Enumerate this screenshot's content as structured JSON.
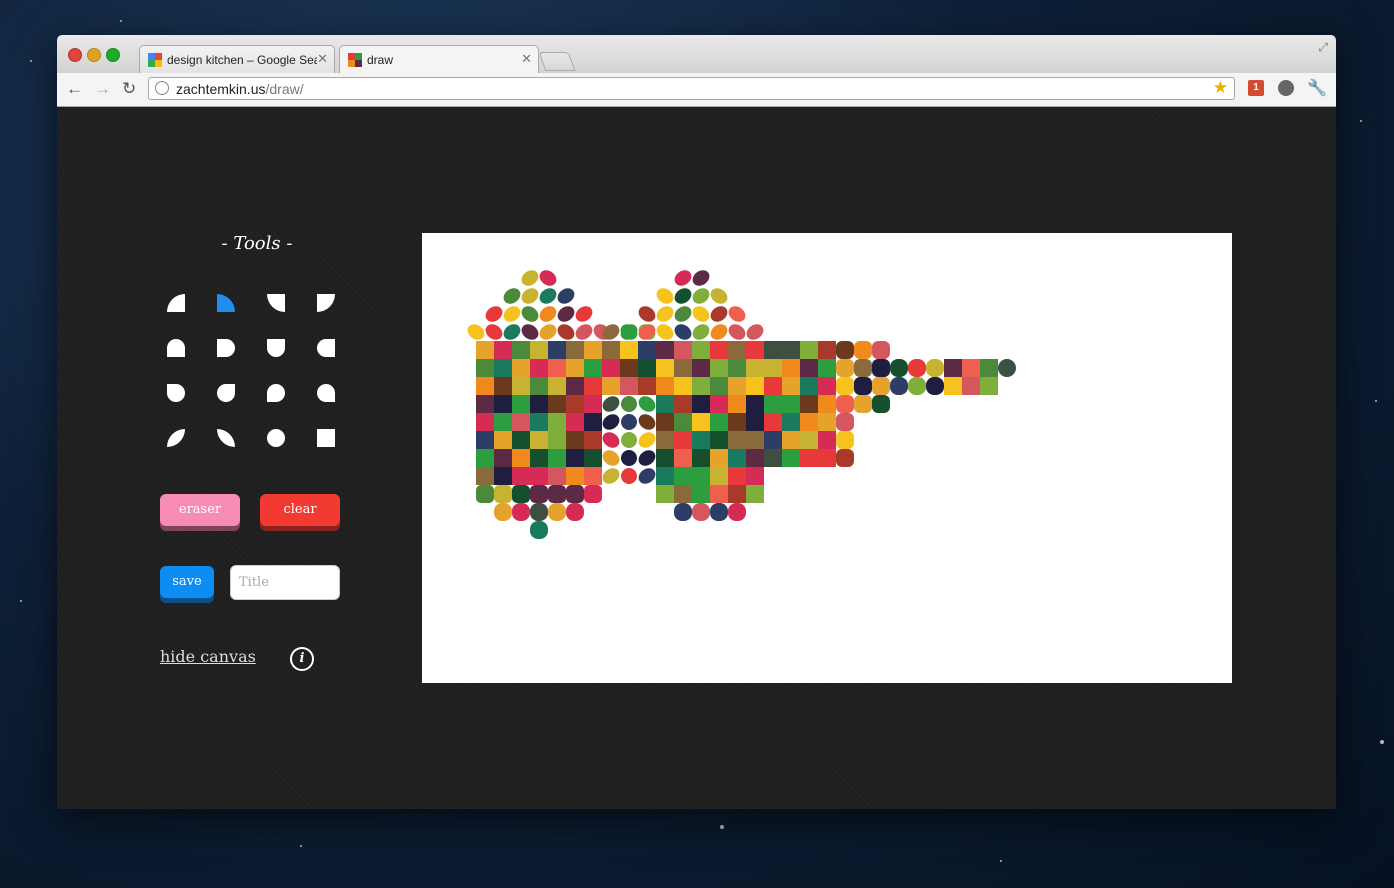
{
  "browser": {
    "tabs": [
      {
        "label": "design kitchen – Google Search",
        "active": false
      },
      {
        "label": "draw",
        "active": true
      }
    ],
    "url_host": "zachtemkin.us",
    "url_path": "/draw/",
    "extension_badge": "1"
  },
  "tools_panel": {
    "title": "- Tools -",
    "tools": [
      {
        "name": "quarter-top-left",
        "selected": false
      },
      {
        "name": "quarter-top-right",
        "selected": true
      },
      {
        "name": "quarter-bottom-left",
        "selected": false
      },
      {
        "name": "quarter-bottom-right",
        "selected": false
      },
      {
        "name": "half-round-top",
        "selected": false
      },
      {
        "name": "half-round-right",
        "selected": false
      },
      {
        "name": "half-round-bottom",
        "selected": false
      },
      {
        "name": "half-round-left",
        "selected": false
      },
      {
        "name": "three-quarter-top-left",
        "selected": false
      },
      {
        "name": "three-quarter-top-right",
        "selected": false
      },
      {
        "name": "three-quarter-bottom-left",
        "selected": false
      },
      {
        "name": "three-quarter-bottom-right",
        "selected": false
      },
      {
        "name": "leaf-left",
        "selected": false
      },
      {
        "name": "leaf-right",
        "selected": false
      },
      {
        "name": "circle",
        "selected": false
      },
      {
        "name": "square",
        "selected": false
      }
    ],
    "eraser_label": "eraser",
    "clear_label": "clear",
    "save_label": "save",
    "title_placeholder": "Title",
    "hide_canvas_label": "hide canvas",
    "info_label": "i"
  },
  "colors": {
    "selected_tool": "#1e8fef",
    "eraser": "#f68cb4",
    "clear": "#f23a33",
    "save": "#0d8cf1",
    "palette": [
      "#e8393a",
      "#2c9e3f",
      "#f08a1c",
      "#c8b232",
      "#5c2a44",
      "#1a7a5e",
      "#ef5f4e",
      "#7fae3a",
      "#d62b55",
      "#e5a32b",
      "#2d3e66",
      "#4b8a3a",
      "#a93a29",
      "#1f1d40",
      "#f6c21d",
      "#6b3a1c",
      "#3c4f40",
      "#8a6a3a",
      "#d4565e",
      "#15502e"
    ]
  }
}
